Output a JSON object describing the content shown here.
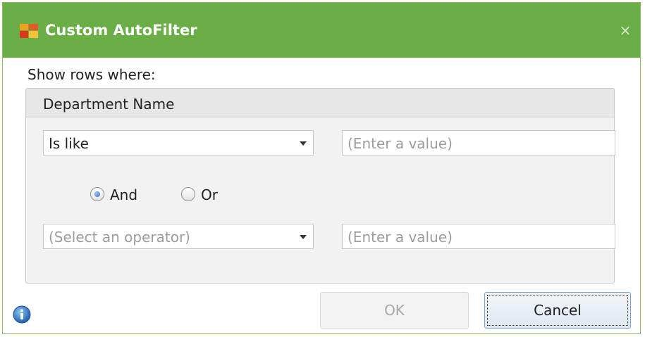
{
  "window": {
    "title": "Custom AutoFilter",
    "close_glyph": "×"
  },
  "prompt_label": "Show rows where:",
  "group": {
    "title": "Department Name",
    "row1": {
      "operator": "Is like",
      "value_placeholder": "(Enter a value)"
    },
    "logic": {
      "and_label": "And",
      "or_label": "Or",
      "selected": "And"
    },
    "row2": {
      "operator_placeholder": "(Select an operator)",
      "value_placeholder": "(Enter a value)"
    }
  },
  "buttons": {
    "ok": "OK",
    "cancel": "Cancel"
  },
  "icons": {
    "app": "table-filter-icon",
    "info": "info-icon",
    "dropdown": "chevron-down-icon"
  },
  "colors": {
    "titlebar": "#6aaf45",
    "accent": "#3d6fb8"
  }
}
